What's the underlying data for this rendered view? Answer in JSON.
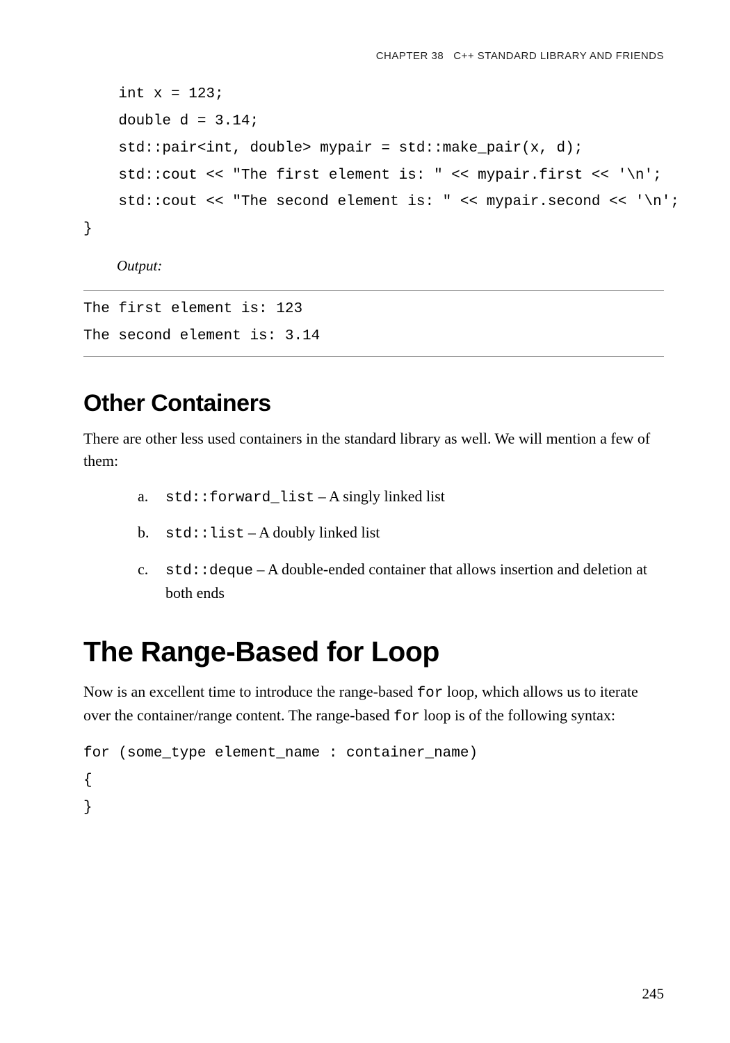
{
  "header": {
    "chapter": "CHAPTER 38",
    "title": "C++ STANDARD LIBRARY AND FRIENDS"
  },
  "code1": {
    "l1": "    int x = 123;",
    "l2": "    double d = 3.14;",
    "l3": "    std::pair<int, double> mypair = std::make_pair(x, d);",
    "l4": "    std::cout << \"The first element is: \" << mypair.first << '\\n';",
    "l5": "    std::cout << \"The second element is: \" << mypair.second << '\\n';",
    "l6": "}"
  },
  "output_label": "Output:",
  "output": {
    "l1": "The first element is: 123",
    "l2": "The second element is: 3.14"
  },
  "section1": {
    "heading": "Other Containers",
    "para": "There are other less used containers in the standard library as well. We will mention a few of them:",
    "items": [
      {
        "marker": "a.",
        "code": "std::forward_list",
        "desc": " – A singly linked list"
      },
      {
        "marker": "b.",
        "code": "std::list",
        "desc": " – A doubly linked list"
      },
      {
        "marker": "c.",
        "code": "std::deque",
        "desc": " – A double-ended container that allows insertion and deletion at both ends"
      }
    ]
  },
  "section2": {
    "heading": "The Range-Based for Loop",
    "para_parts": {
      "p1": "Now is an excellent time to introduce the range-based ",
      "c1": "for",
      "p2": " loop, which allows us to iterate over the container/range content. The range-based ",
      "c2": "for",
      "p3": " loop is of the following syntax:"
    }
  },
  "code2": {
    "l1": "for (some_type element_name : container_name)",
    "l2": "{",
    "l3": "}"
  },
  "page_number": "245"
}
